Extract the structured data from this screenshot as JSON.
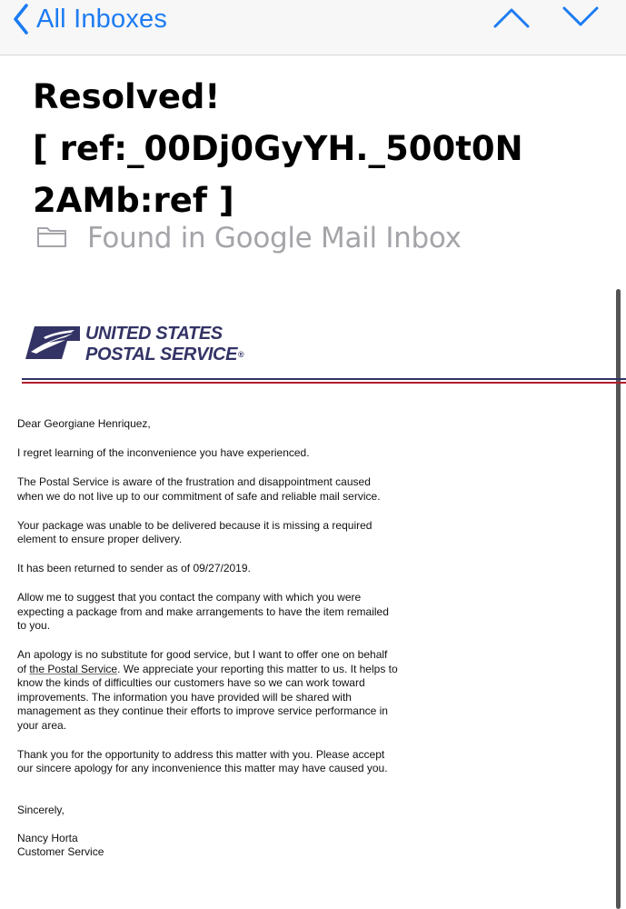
{
  "nav": {
    "back_label": "All Inboxes",
    "icons": [
      "chevron-left-icon",
      "chevron-up-icon",
      "chevron-down-icon"
    ],
    "accent_color": "#1d7cf2"
  },
  "email": {
    "subject_lines": [
      "Resolved!",
      "[ ref:_00Dj0GyYH._500t0N",
      "2AMb:ref ]"
    ],
    "folder_label": "Found in Google Mail Inbox",
    "folder_icon": "folder-icon"
  },
  "letter": {
    "logo_line1": "UNITED STATES",
    "logo_line2": "POSTAL SERVICE",
    "logo_reg": "®",
    "brand_colors": {
      "navy": "#333366",
      "red": "#b21c2e"
    },
    "greeting": "Dear Georgiane Henriquez,",
    "p1": "I regret learning of the inconvenience you have experienced.",
    "p2": "The Postal Service is aware of the frustration and disappointment caused when we do not live up to our commitment of safe and reliable mail service.",
    "p3": "Your package was unable to be delivered because it is missing a required element to ensure proper delivery.",
    "p4": "It has been returned to sender as of 09/27/2019.",
    "p5": "Allow me to suggest that you contact the company with which you were expecting a package from and make arrangements to have the item remailed to you.",
    "p6_a": "An apology is no substitute for good service, but I want to offer one on behalf of ",
    "p6_link": "the Postal Service",
    "p6_b": ". We appreciate your reporting this matter to us. It helps to know the kinds of difficulties our customers have so we can work toward improvements. The information you have provided will be shared with management as they continue their efforts to improve service performance in your area.",
    "p7": "Thank you for the opportunity to address this matter with you. Please accept our sincere apology for any inconvenience this matter may have caused you.",
    "closing": "Sincerely,",
    "signer_name": "Nancy Horta",
    "signer_title": "Customer Service"
  }
}
